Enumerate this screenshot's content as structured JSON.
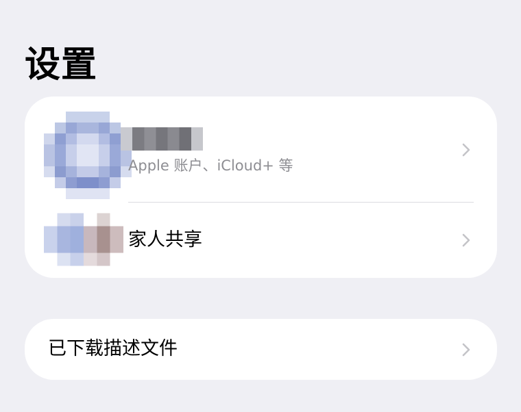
{
  "header": {
    "title": "设置"
  },
  "account": {
    "name_redacted": true,
    "subtitle": "Apple 账户、iCloud+ 等"
  },
  "family": {
    "label": "家人共享"
  },
  "profiles": {
    "label": "已下载描述文件"
  },
  "icons": {
    "row_chevron": "chevron-right-icon"
  },
  "colors": {
    "background": "#efeff4",
    "card": "#ffffff",
    "secondary_text": "#8e8e93",
    "chevron": "#c4c4c8",
    "separator": "#dcdce0"
  }
}
